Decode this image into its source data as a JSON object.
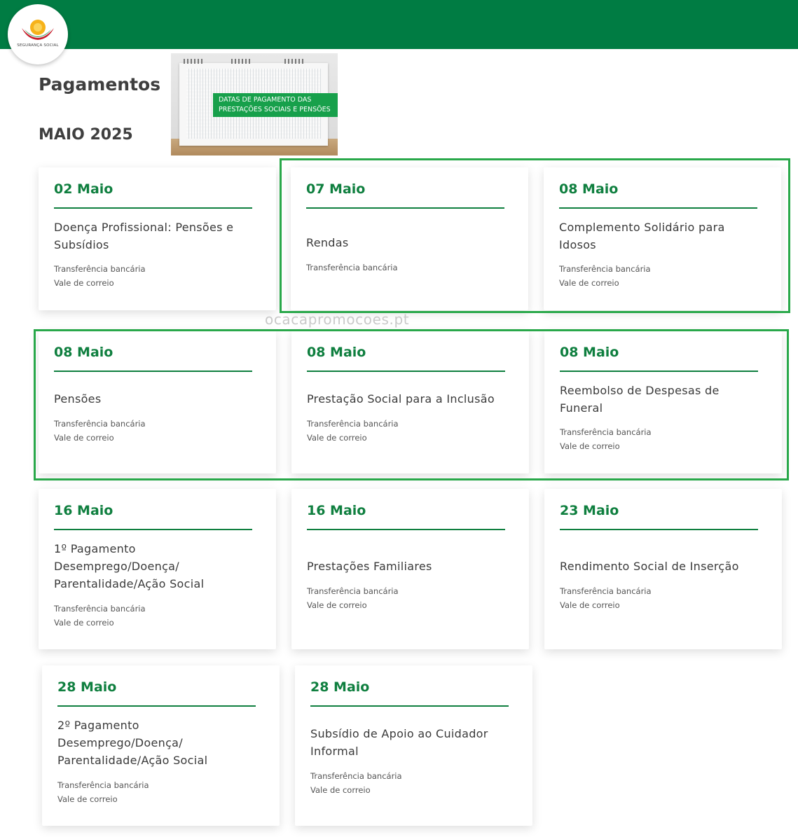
{
  "header": {
    "logo_text": "SEGURANÇA SOCIAL",
    "brand_color": "#007c43",
    "logo_icon": "seguranca-social-logo-icon"
  },
  "page": {
    "title": "Pagamentos",
    "month": "MAIO 2025"
  },
  "image": {
    "banner_line1": "DATAS DE PAGAMENTO DAS",
    "banner_line2": "PRESTAÇÕES SOCIAIS E PENSÕES"
  },
  "watermark": "ocacapromocoes.pt",
  "cards": [
    {
      "date": "02 Maio",
      "name": "Doença Profissional: Pensões e Subsídios",
      "methods": [
        "Transferência bancária",
        "Vale de correio"
      ]
    },
    {
      "date": "07 Maio",
      "name": "Rendas",
      "methods": [
        "Transferência bancária"
      ]
    },
    {
      "date": "08 Maio",
      "name": "Complemento Solidário para Idosos",
      "methods": [
        "Transferência bancária",
        "Vale de correio"
      ]
    },
    {
      "date": "08 Maio",
      "name": "Pensões",
      "methods": [
        "Transferência bancária",
        "Vale de correio"
      ]
    },
    {
      "date": "08 Maio",
      "name": "Prestação Social para a Inclusão",
      "methods": [
        "Transferência bancária",
        "Vale de correio"
      ]
    },
    {
      "date": "08 Maio",
      "name": "Reembolso de Despesas de Funeral",
      "methods": [
        "Transferência bancária",
        "Vale de correio"
      ]
    },
    {
      "date": "16 Maio",
      "name": "1º Pagamento Desemprego/Doença/ Parentalidade/Ação Social",
      "methods": [
        "Transferência bancária",
        "Vale de correio"
      ]
    },
    {
      "date": "16 Maio",
      "name": "Prestações Familiares",
      "methods": [
        "Transferência bancária",
        "Vale de correio"
      ]
    },
    {
      "date": "23 Maio",
      "name": "Rendimento Social de Inserção",
      "methods": [
        "Transferência bancária",
        "Vale de correio"
      ]
    },
    {
      "date": "28 Maio",
      "name": "2º Pagamento Desemprego/Doença/ Parentalidade/Ação Social",
      "methods": [
        "Transferência bancária",
        "Vale de correio"
      ]
    },
    {
      "date": "28 Maio",
      "name": "Subsídio de Apoio ao Cuidador Informal",
      "methods": [
        "Transferência bancária",
        "Vale de correio"
      ]
    }
  ]
}
